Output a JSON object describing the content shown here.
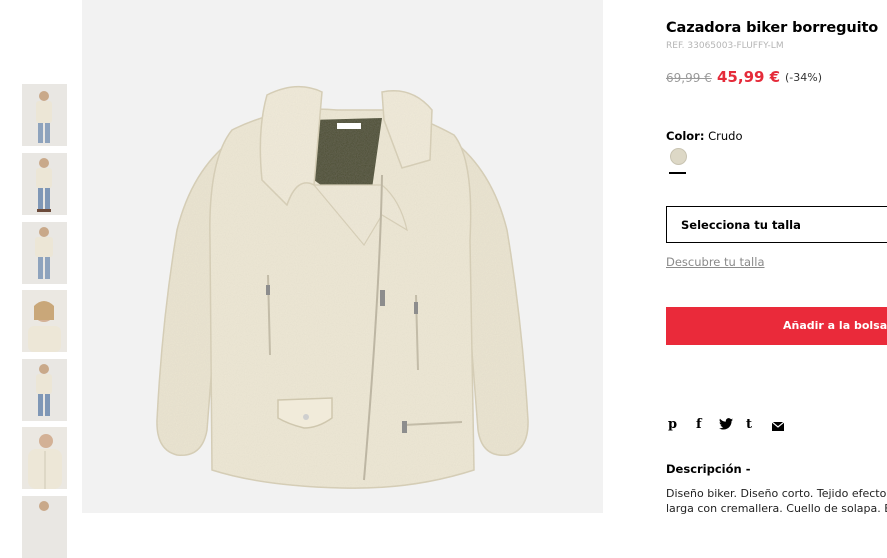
{
  "product": {
    "title": "Cazadora biker borreguito",
    "ref": "REF. 33065003-FLUFFY-LM",
    "old_price": "69,99 €",
    "new_price": "45,99 €",
    "discount": "(-34%)"
  },
  "color": {
    "label": "Color:",
    "value": "Crudo",
    "swatch_hex": "#ddd8c6"
  },
  "size": {
    "select_label": "Selecciona tu talla",
    "guide_link": "Descubre tu talla"
  },
  "cart": {
    "add_label": "Añadir a la bolsa",
    "accent": "#ea2a3a"
  },
  "share": {
    "icons": [
      "pinterest-icon",
      "facebook-icon",
      "twitter-icon",
      "tumblr-icon",
      "email-icon"
    ],
    "pinterest": "p",
    "facebook": "f",
    "tumblr": "t"
  },
  "description": {
    "title": "Descripción -",
    "line1": "Diseño biker. Diseño corto. Tejido efecto bo",
    "line2": "larga con cremallera. Cuello de solapa. Bo"
  }
}
